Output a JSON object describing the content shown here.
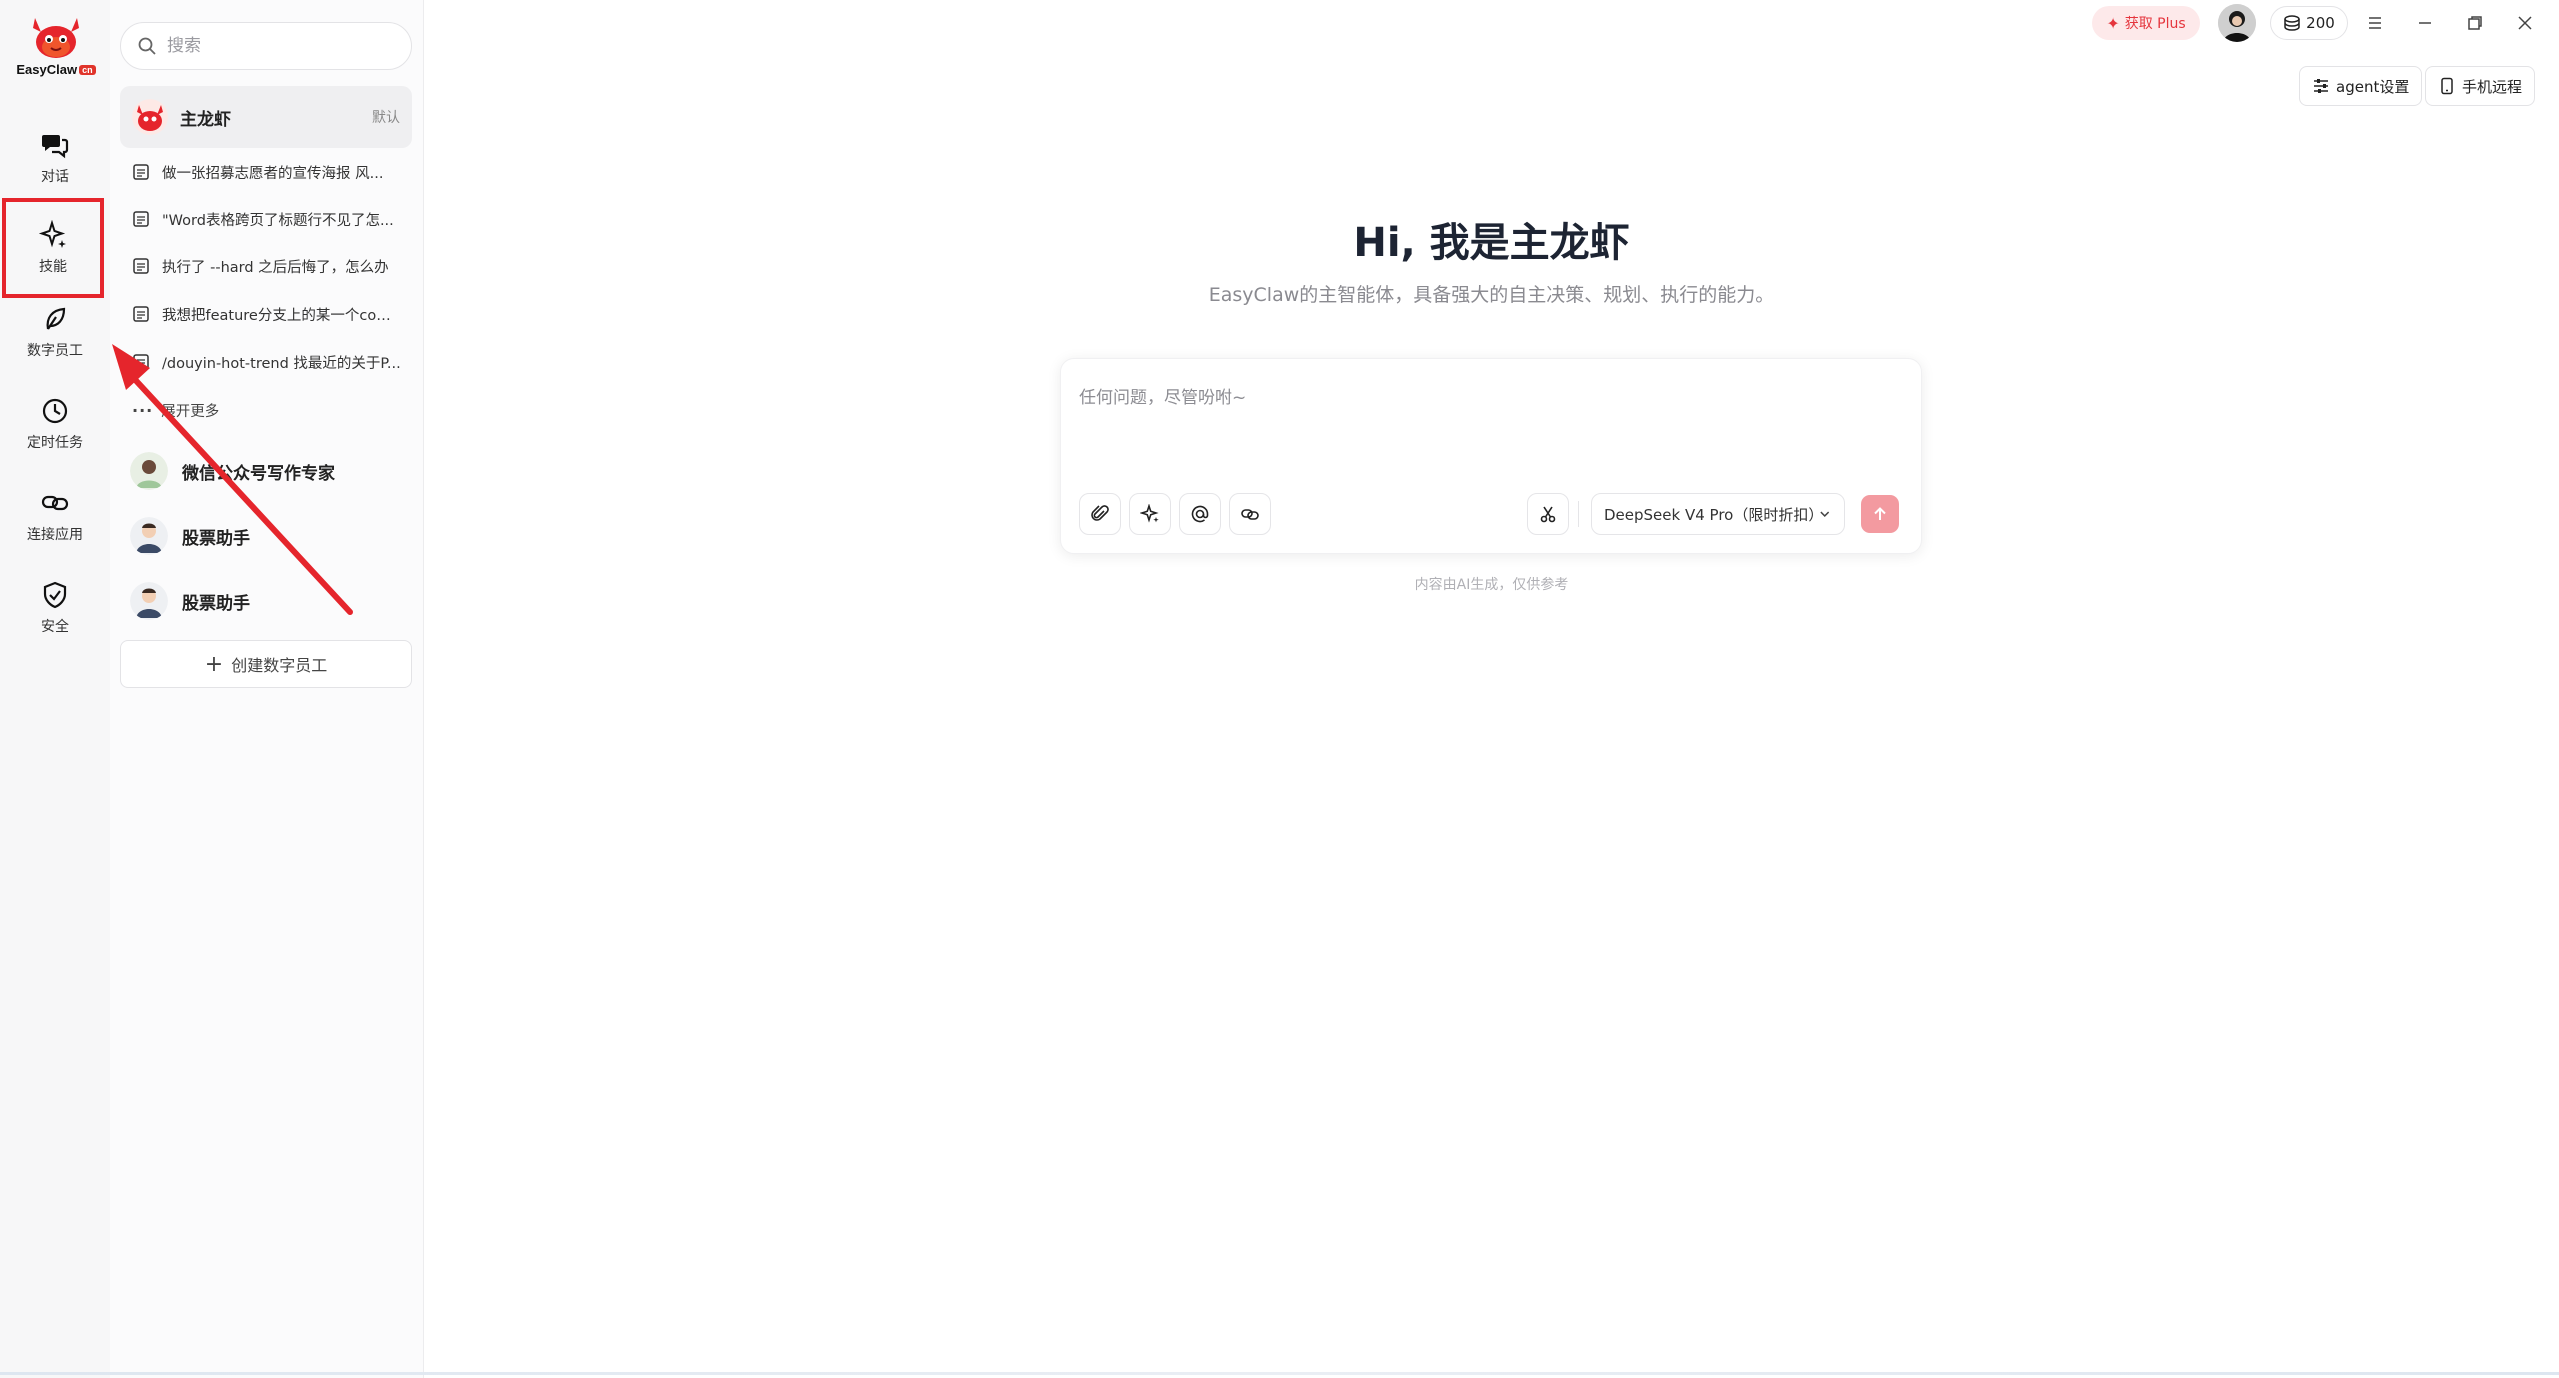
{
  "app": {
    "logo_text": "EasyClaw",
    "logo_badge": "cn"
  },
  "rail": {
    "items": [
      {
        "label": "对话",
        "icon": "chat-icon"
      },
      {
        "label": "技能",
        "icon": "sparkle-icon"
      },
      {
        "label": "数字员工",
        "icon": "leaf-icon"
      },
      {
        "label": "定时任务",
        "icon": "clock-icon"
      },
      {
        "label": "连接应用",
        "icon": "link-icon"
      },
      {
        "label": "安全",
        "icon": "shield-icon"
      }
    ]
  },
  "panel": {
    "search_placeholder": "搜索",
    "main_agent": {
      "name": "主龙虾",
      "tag": "默认"
    },
    "conversations": [
      "做一张招募志愿者的宣传海报 风...",
      "\"Word表格跨页了标题行不见了怎...",
      "执行了 --hard 之后后悔了，怎么办",
      "我想把feature分支上的某一个com...",
      "/douyin-hot-trend 找最近的关于P..."
    ],
    "more_label": "展开更多",
    "agents": [
      {
        "name": "微信公众号写作专家"
      },
      {
        "name": "股票助手"
      },
      {
        "name": "股票助手"
      }
    ],
    "create_label": "创建数字员工"
  },
  "topbar": {
    "plus_label": "获取 Plus",
    "credits": "200",
    "agent_settings_label": "agent设置",
    "mobile_remote_label": "手机远程"
  },
  "hero": {
    "title": "Hi, 我是主龙虾",
    "subtitle": "EasyClaw的主智能体，具备强大的自主决策、规划、执行的能力。"
  },
  "composer": {
    "placeholder": "任何问题，尽管吩咐~",
    "model": "DeepSeek V4 Pro（限时折扣）"
  },
  "disclaimer": "内容由AI生成，仅供参考",
  "colors": {
    "accent_red": "#e5252c",
    "send_button": "#f39aa0",
    "plus_bg": "#fde9ea"
  }
}
